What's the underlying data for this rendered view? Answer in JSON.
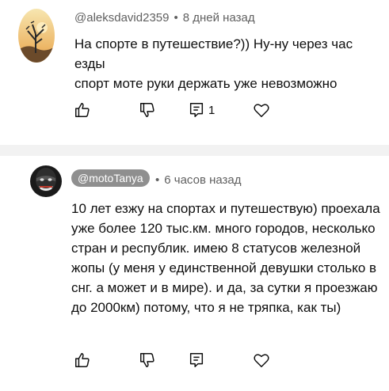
{
  "comments": [
    {
      "author": "@aleksdavid2359",
      "time": "8 дней назад",
      "separator": "•",
      "text_lines": [
        "На спорте в путешествие?)) Ну-ну через час езды",
        "спорт моте руки держать уже невозможно"
      ],
      "reply_count": "1"
    },
    {
      "author": "@motoTanya",
      "time": "6 часов назад",
      "separator": "•",
      "text_lines": [
        "10 лет езжу на спортах и путешествую) проехала",
        "уже более 120 тыс.км. много городов, несколько",
        "стран и республик. имею 8 статусов железной",
        "жопы (у меня у единственной девушки столько в",
        "снг. а может и в мире). и да, за сутки я проезжаю",
        "до 2000км) потому, что я не тряпка, как ты)"
      ]
    }
  ],
  "icons": {
    "like": "thumb-up-icon",
    "dislike": "thumb-down-icon",
    "reply": "reply-icon",
    "heart": "heart-icon"
  },
  "colors": {
    "separator_band": "#f2f2f2",
    "meta_text": "#606060",
    "author_chip_bg": "#8f8f8f"
  }
}
